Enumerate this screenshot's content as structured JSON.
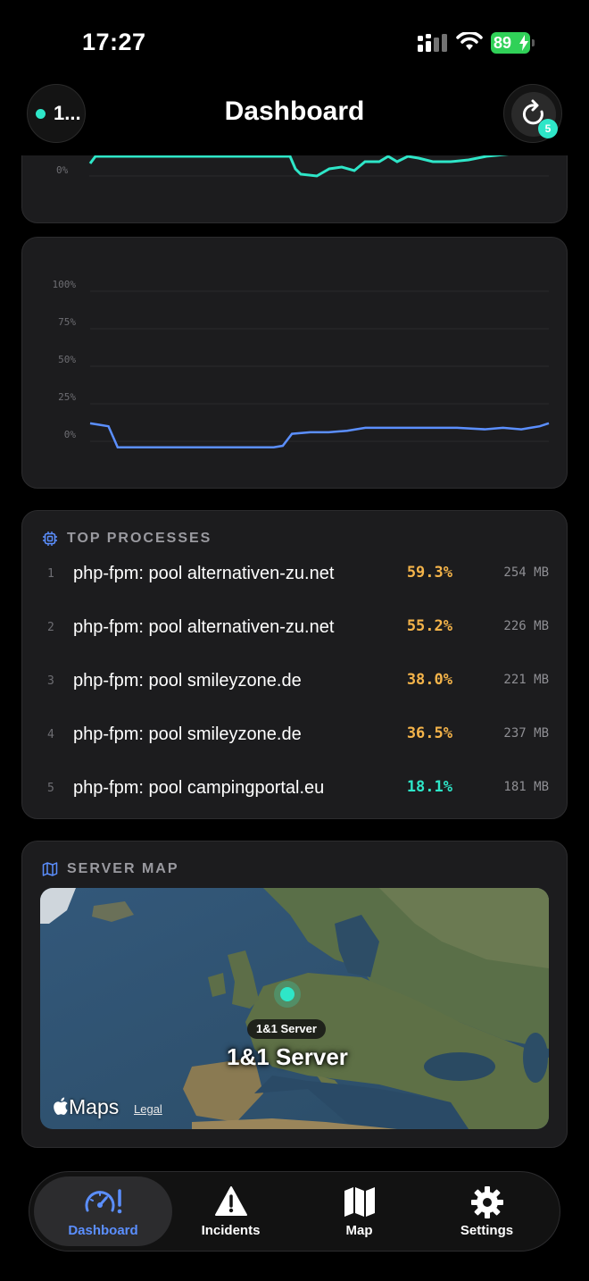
{
  "status_bar": {
    "time": "17:27",
    "battery": "89"
  },
  "header": {
    "server_label": "1...",
    "title": "Dashboard",
    "refresh_badge": "5"
  },
  "top_chart": {
    "y_tick": "0%"
  },
  "chart": {
    "y_ticks": [
      "100%",
      "75%",
      "50%",
      "25%",
      "0%"
    ],
    "line_color": "#5b8fff",
    "ylim": [
      0,
      100
    ]
  },
  "top_processes": {
    "title": "TOP PROCESSES",
    "rows": [
      {
        "rank": "1",
        "name": "php-fpm: pool alternativen-zu.net",
        "cpu": "59.3%",
        "mem": "254 MB",
        "cpu_color": "#f5b44a"
      },
      {
        "rank": "2",
        "name": "php-fpm: pool alternativen-zu.net",
        "cpu": "55.2%",
        "mem": "226 MB",
        "cpu_color": "#f5b44a"
      },
      {
        "rank": "3",
        "name": "php-fpm: pool smileyzone.de",
        "cpu": "38.0%",
        "mem": "221 MB",
        "cpu_color": "#f5b44a"
      },
      {
        "rank": "4",
        "name": "php-fpm: pool smileyzone.de",
        "cpu": "36.5%",
        "mem": "237 MB",
        "cpu_color": "#f5b44a"
      },
      {
        "rank": "5",
        "name": "php-fpm: pool campingportal.eu",
        "cpu": "18.1%",
        "mem": "181 MB",
        "cpu_color": "#2ee6c8"
      }
    ]
  },
  "server_map": {
    "title": "SERVER MAP",
    "pin_tag": "1&1 Server",
    "pin_label": "1&1 Server",
    "brand": "Maps",
    "legal": "Legal"
  },
  "tabs": [
    {
      "label": "Dashboard",
      "icon": "gauge-icon",
      "active": true
    },
    {
      "label": "Incidents",
      "icon": "warning-icon",
      "active": false
    },
    {
      "label": "Map",
      "icon": "map-icon",
      "active": false
    },
    {
      "label": "Settings",
      "icon": "gear-icon",
      "active": false
    }
  ],
  "colors": {
    "accent": "#5b8fff",
    "teal": "#2ee6c8",
    "warn": "#f5b44a",
    "battery": "#30d158"
  }
}
